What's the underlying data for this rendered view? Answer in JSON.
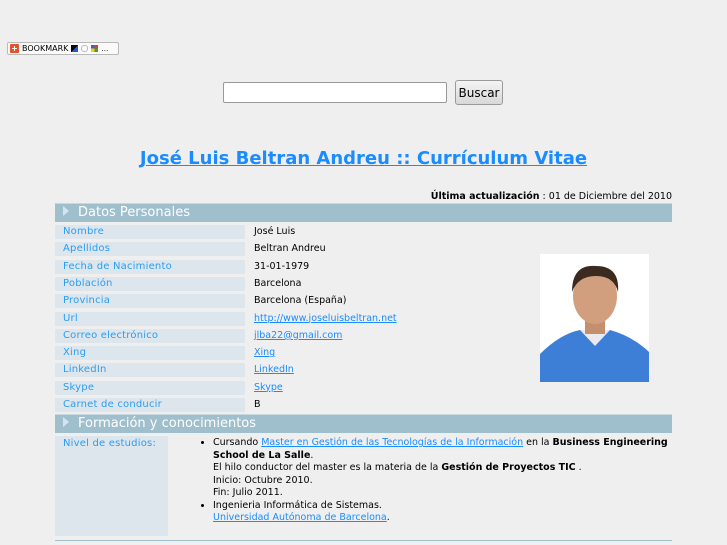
{
  "bookmark": {
    "label": "BOOKMARK"
  },
  "search": {
    "value": "",
    "button": "Buscar"
  },
  "title": "José Luis Beltran Andreu :: Currículum Vitae",
  "update": {
    "label": "Última actualización",
    "value": " : 01 de Diciembre del 2010"
  },
  "sections": {
    "personal": "Datos Personales",
    "formacion": "Formación y conocimientos"
  },
  "personal": [
    {
      "label": "Nombre",
      "value": "José Luis"
    },
    {
      "label": "Apellidos",
      "value": "Beltran Andreu"
    },
    {
      "label": "Fecha de Nacimiento",
      "value": "31-01-1979"
    },
    {
      "label": "Población",
      "value": "Barcelona"
    },
    {
      "label": "Provincia",
      "value": "Barcelona (España)"
    },
    {
      "label": "Url",
      "value": "http://www.joseluisbeltran.net",
      "link": true
    },
    {
      "label": "Correo electrónico",
      "value": "jlba22@gmail.com",
      "link": true
    },
    {
      "label": "Xing",
      "value": "Xing",
      "link": true
    },
    {
      "label": "LinkedIn",
      "value": "LinkedIn",
      "link": true
    },
    {
      "label": "Skype",
      "value": "Skype",
      "link": true
    },
    {
      "label": "Carnet de conducir",
      "value": "B"
    }
  ],
  "education": {
    "label": "Nivel de estudios:",
    "item1": {
      "pre": "Cursando ",
      "link": "Master en Gestión de las Tecnologías de la Información",
      "mid": " en la ",
      "bold": "Business Engineering School de La Salle",
      "end": ".",
      "line2": "El hilo conductor del master es la materia de la ",
      "bold2": "Gestión de Proyectos TIC",
      "end2": " .",
      "line3": "Inicio: Octubre 2010.",
      "line4": "Fin: Julio 2011."
    },
    "item2": {
      "text": "Ingenieria Informática de Sistemas.",
      "link": "Universidad Autónoma de Barcelona",
      "end": "."
    }
  }
}
